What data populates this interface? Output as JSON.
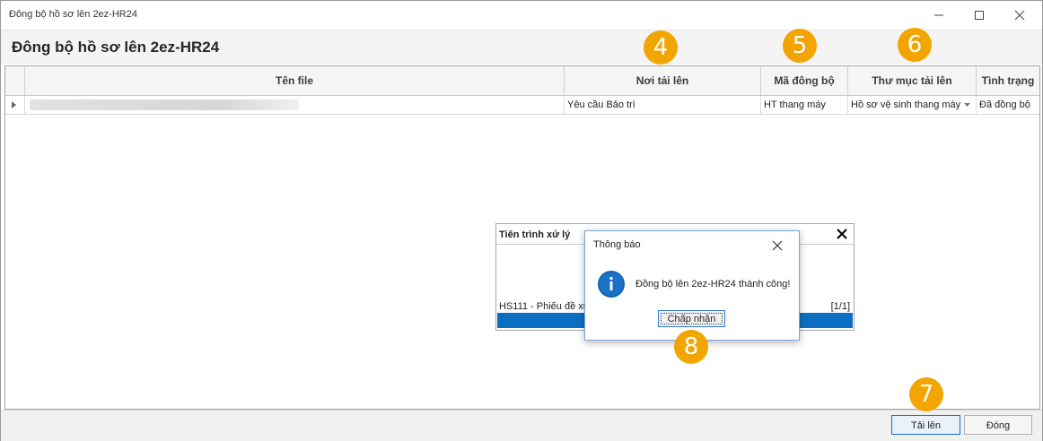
{
  "window": {
    "title": "Đông bộ hồ sơ lên 2ez-HR24",
    "minimize_icon": "minimize-icon",
    "maximize_icon": "maximize-icon",
    "close_icon": "close-icon"
  },
  "form": {
    "title": "Đông bộ hồ sơ lên 2ez-HR24"
  },
  "grid": {
    "columns": [
      "Tên file",
      "Nơi tải lên",
      "Mã đông bộ",
      "Thư mục tải lên",
      "Tình trạng"
    ],
    "rows": [
      {
        "file_name": "",
        "upload_location": "Yêu cầu Bảo trì",
        "sync_code": "HT thang máy",
        "upload_folder": "Hồ sơ vệ sinh thang máy",
        "status": "Đã đồng bộ"
      }
    ]
  },
  "badges": [
    "4",
    "5",
    "6",
    "7",
    "8"
  ],
  "progress_panel": {
    "title": "Tiên trình xử lý",
    "item_text": "HS111 - Phiếu đề xu",
    "counter": "[1/1]",
    "progress_fraction": 1.0
  },
  "dialog": {
    "title": "Thông báo",
    "message": "Đồng bộ lên 2ez-HR24 thành công!",
    "ok_label": "Chấp nhận",
    "icon": "info-icon"
  },
  "footer": {
    "upload_label": "Tải lên",
    "close_label": "Đóng"
  },
  "colors": {
    "accent": "#0a6fc2",
    "badge": "#f2a500"
  }
}
